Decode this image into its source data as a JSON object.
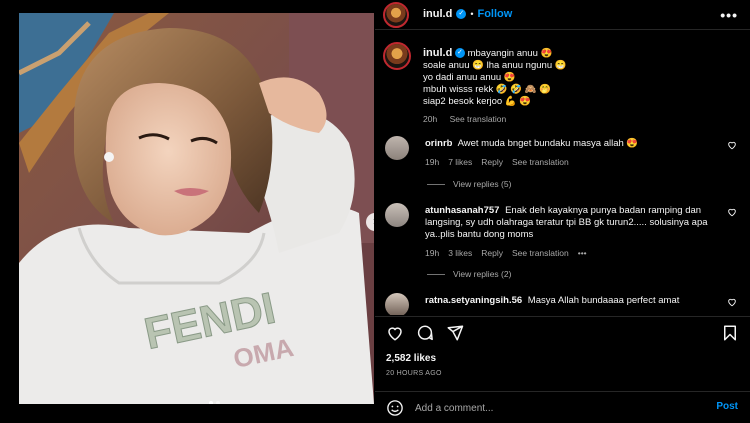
{
  "header": {
    "username": "inul.d",
    "separator": "•",
    "follow_label": "Follow",
    "more_label": "•••"
  },
  "caption": {
    "username": "inul.d",
    "lines": [
      "mbayangin anuu 😍",
      "soale anuu 😁 lha anuu ngunu 😁",
      "yo dadi anuu anuu 😍",
      "mbuh wisss rekk 🤣 🤣 🙈 🤭",
      "siap2 besok kerjoo 💪 😍"
    ],
    "time": "20h",
    "see_translation": "See translation"
  },
  "comments": [
    {
      "username": "orinrb",
      "text": "Awet muda bnget bundaku masya allah 😍",
      "time": "19h",
      "likes": "7 likes",
      "reply": "Reply",
      "see_translation": "See translation",
      "view_replies": "View replies (5)"
    },
    {
      "username": "atunhasanah757",
      "text": "Enak deh kayaknya punya badan ramping dan langsing, sy udh olahraga teratur tpi BB gk turun2..... solusinya apa ya..plis bantu dong moms",
      "time": "19h",
      "likes": "3 likes",
      "reply": "Reply",
      "see_translation": "See translation",
      "more": "•••",
      "view_replies": "View replies (2)"
    },
    {
      "username": "ratna.setyaningsih.56",
      "text": "Masya Allah bundaaaa perfect amat"
    }
  ],
  "actions": {
    "icons": [
      "heart-icon",
      "comment-icon",
      "share-icon",
      "bookmark-icon"
    ],
    "likes": "2,582 likes",
    "time_ago": "20 HOURS AGO"
  },
  "add_comment": {
    "placeholder": "Add a comment...",
    "post_label": "Post"
  },
  "media": {
    "carousel_index": 1,
    "carousel_count": 2,
    "next_label": "›"
  },
  "colors": {
    "background": "#000000",
    "link_blue": "#0095f6",
    "muted": "#a8a8a8",
    "divider": "#262626"
  }
}
